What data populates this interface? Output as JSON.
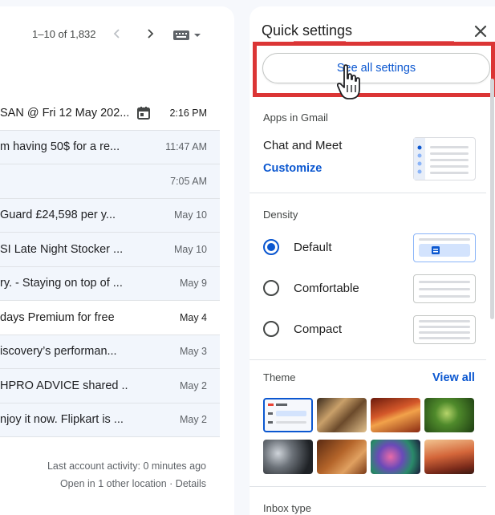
{
  "mail": {
    "pager_text": "1–10 of 1,832",
    "rows": [
      {
        "subject": "SAN @ Fri 12 May 202...",
        "time": "2:16 PM",
        "unread": true
      },
      {
        "subject": "m having 50$ for a re...",
        "time": "11:47 AM",
        "unread": false
      },
      {
        "subject": "",
        "time": "7:05 AM",
        "unread": false
      },
      {
        "subject": "Guard £24,598 per y...",
        "time": "May 10",
        "unread": false
      },
      {
        "subject": "SI Late Night Stocker ...",
        "time": "May 10",
        "unread": false
      },
      {
        "subject": "ry. - Staying on top of ...",
        "time": "May 9",
        "unread": false
      },
      {
        "subject": " days Premium for free",
        "time": "May 4",
        "unread": true
      },
      {
        "subject": "iscovery’s performan...",
        "time": "May 3",
        "unread": false
      },
      {
        "subject": "HPRO ADVICE shared ...",
        "time": "May 2",
        "unread": false
      },
      {
        "subject": "njoy it now. Flipkart is ...",
        "time": "May 2",
        "unread": false
      }
    ],
    "activity_line1": "Last account activity: 0 minutes ago",
    "activity_line2": "Open in 1 other location · Details"
  },
  "quick_settings": {
    "title": "Quick settings",
    "see_all_label": "See all settings",
    "apps_section": "Apps in Gmail",
    "chat_meet_label": "Chat and Meet",
    "customize_label": "Customize",
    "density_section": "Density",
    "density_options": [
      {
        "label": "Default",
        "selected": true
      },
      {
        "label": "Comfortable",
        "selected": false
      },
      {
        "label": "Compact",
        "selected": false
      }
    ],
    "theme_section": "Theme",
    "view_all_label": "View all",
    "inbox_section": "Inbox type"
  },
  "colors": {
    "accent": "#0b57d0",
    "highlight_box": "#db3535",
    "background": "#f6f8fc"
  },
  "icons": [
    "chevron-left-icon",
    "chevron-right-icon",
    "keyboard-icon",
    "calendar-icon",
    "close-icon",
    "hand-cursor-icon"
  ]
}
